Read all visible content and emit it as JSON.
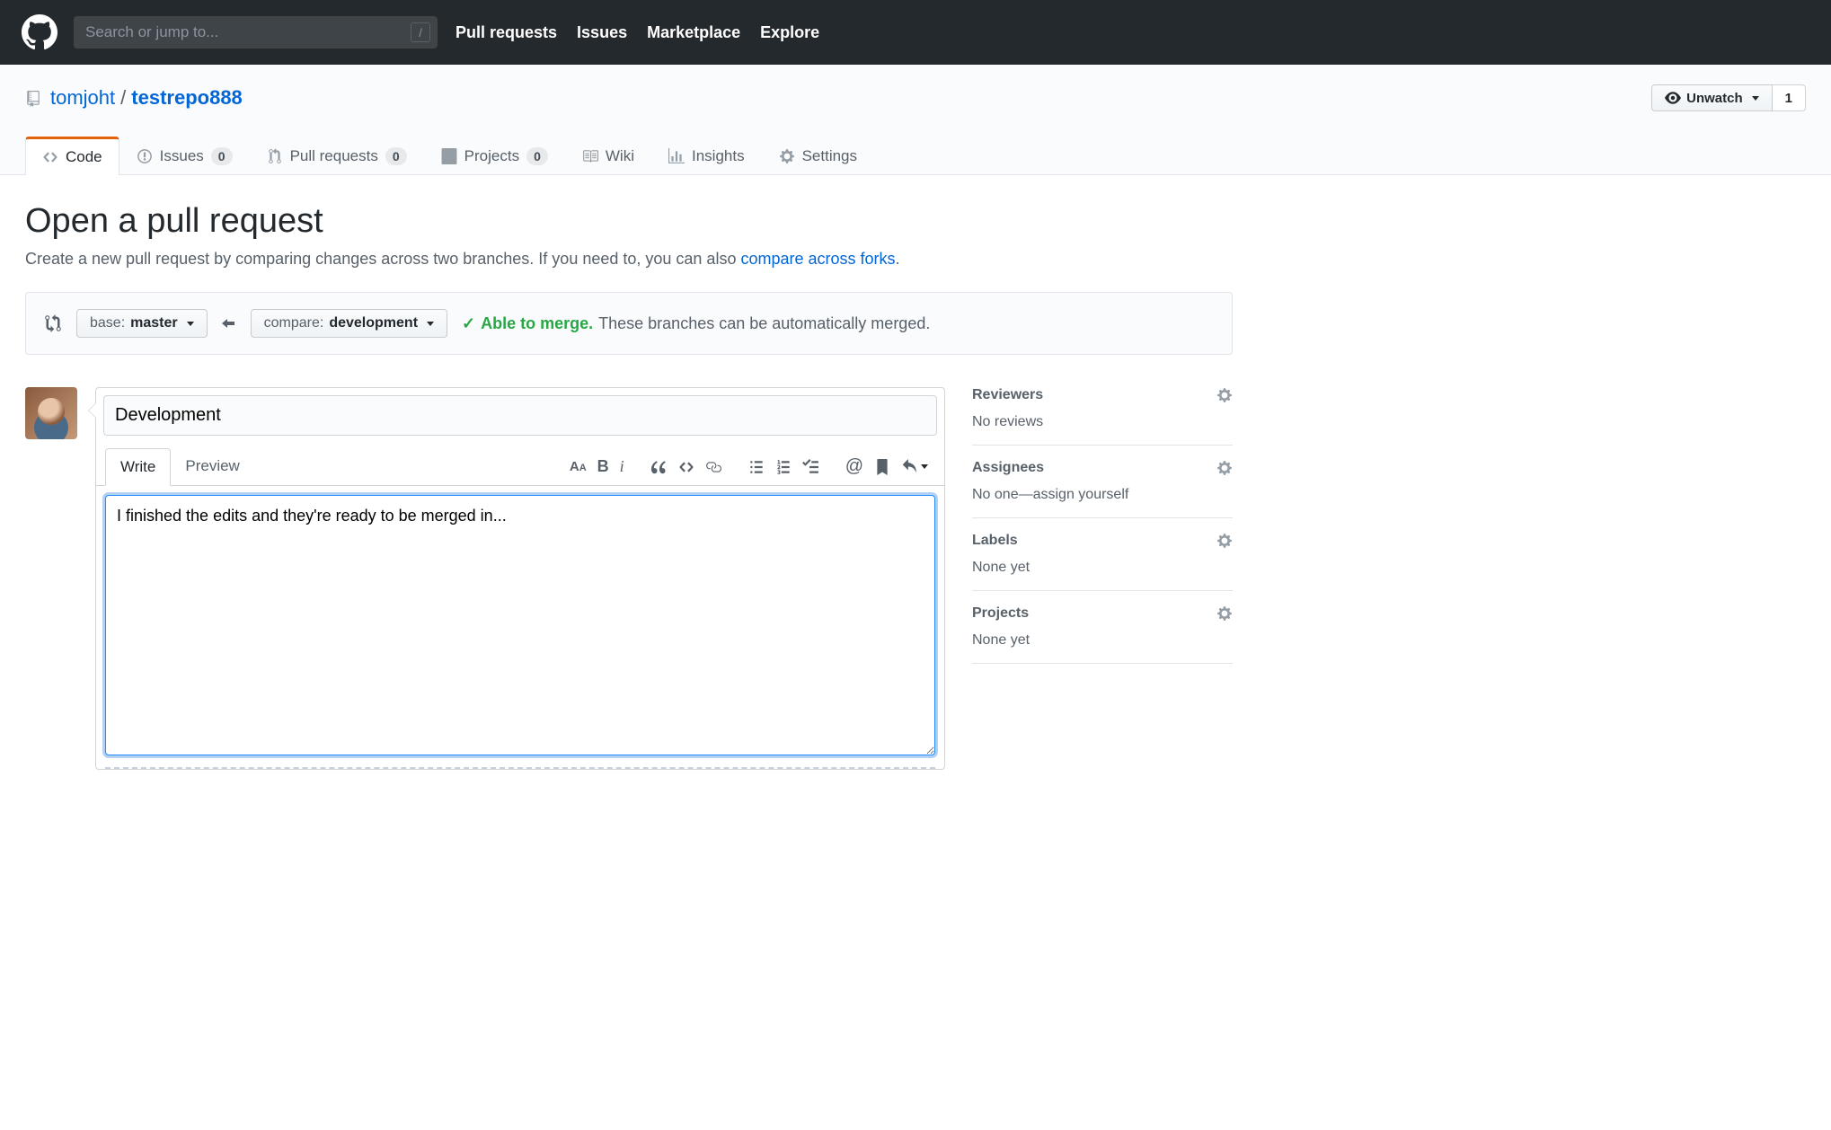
{
  "header": {
    "search_placeholder": "Search or jump to...",
    "slash_key": "/",
    "nav": [
      "Pull requests",
      "Issues",
      "Marketplace",
      "Explore"
    ]
  },
  "repo": {
    "owner": "tomjoht",
    "name": "testrepo888",
    "watch_label": "Unwatch",
    "watch_count": "1"
  },
  "tabs": {
    "code": "Code",
    "issues": "Issues",
    "issues_count": "0",
    "prs": "Pull requests",
    "prs_count": "0",
    "projects": "Projects",
    "projects_count": "0",
    "wiki": "Wiki",
    "insights": "Insights",
    "settings": "Settings"
  },
  "page": {
    "title": "Open a pull request",
    "subtitle_pre": "Create a new pull request by comparing changes across two branches. If you need to, you can also ",
    "subtitle_link": "compare across forks",
    "subtitle_post": "."
  },
  "compare": {
    "base_label": "base: ",
    "base_value": "master",
    "compare_label": "compare: ",
    "compare_value": "development",
    "able_label": "Able to merge.",
    "merge_text": "These branches can be automatically merged."
  },
  "form": {
    "title_value": "Development",
    "tab_write": "Write",
    "tab_preview": "Preview",
    "description_value": "I finished the edits and they're ready to be merged in..."
  },
  "sidebar": {
    "reviewers_title": "Reviewers",
    "reviewers_text": "No reviews",
    "assignees_title": "Assignees",
    "assignees_text": "No one—assign yourself",
    "labels_title": "Labels",
    "labels_text": "None yet",
    "projects_title": "Projects",
    "projects_text": "None yet"
  }
}
